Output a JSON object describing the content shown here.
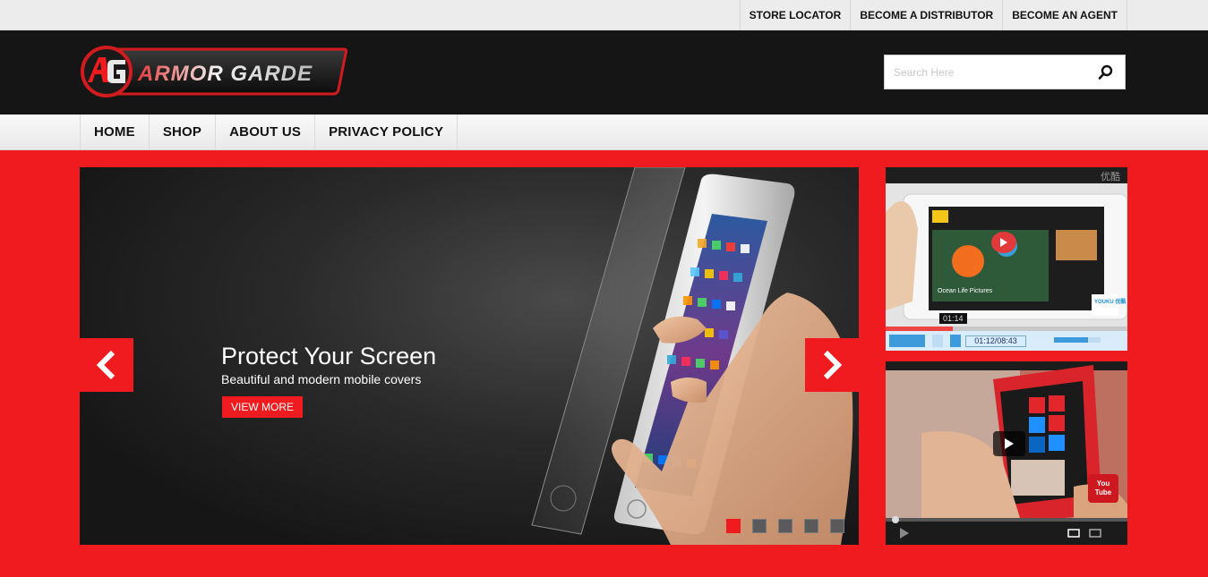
{
  "top_links": [
    "STORE LOCATOR",
    "BECOME A DISTRIBUTOR",
    "BECOME AN AGENT"
  ],
  "logo": {
    "text": "ARMOR GARDE",
    "monogram": "AG"
  },
  "search": {
    "placeholder": "Search Here",
    "icon": "search-icon"
  },
  "nav": [
    "HOME",
    "SHOP",
    "ABOUT US",
    "PRIVACY POLICY"
  ],
  "slider": {
    "title": "Protect Your Screen",
    "subtitle": "Beautiful and modern mobile covers",
    "button": "VIEW MORE",
    "slide_count": 5,
    "active_slide": 1
  },
  "video1": {
    "corner_text": "优酷",
    "tooltip_time": "01:14",
    "timecode": "01:12/08:43",
    "brand": "YOUKU 优酷",
    "screen_title": "Ocean Life Pictures"
  },
  "video2": {
    "brand_top": "You",
    "brand_bottom": "Tube"
  },
  "colors": {
    "accent": "#ef1b1f",
    "header_bg": "#151515",
    "topbar_bg": "#ececec"
  }
}
